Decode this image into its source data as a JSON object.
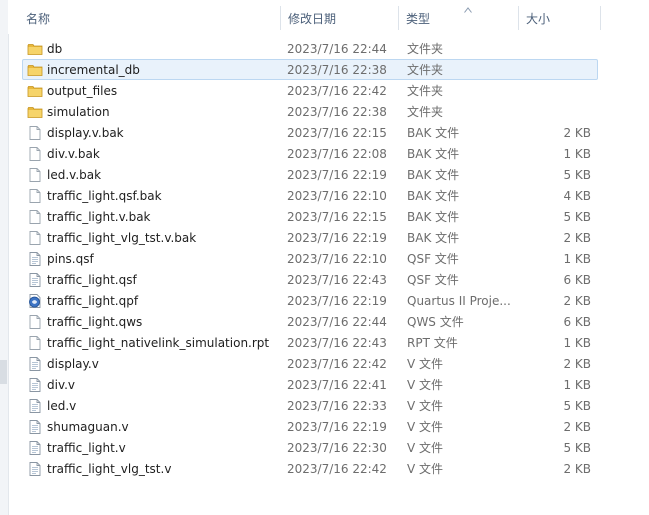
{
  "columns": {
    "name": "名称",
    "date": "修改日期",
    "type": "类型",
    "size": "大小"
  },
  "files": [
    {
      "name": "db",
      "date": "2023/7/16 22:44",
      "type": "文件夹",
      "size": "",
      "icon": "folder-icon"
    },
    {
      "name": "incremental_db",
      "date": "2023/7/16 22:38",
      "type": "文件夹",
      "size": "",
      "icon": "folder-icon",
      "selected": true
    },
    {
      "name": "output_files",
      "date": "2023/7/16 22:42",
      "type": "文件夹",
      "size": "",
      "icon": "folder-icon"
    },
    {
      "name": "simulation",
      "date": "2023/7/16 22:38",
      "type": "文件夹",
      "size": "",
      "icon": "folder-icon"
    },
    {
      "name": "display.v.bak",
      "date": "2023/7/16 22:15",
      "type": "BAK 文件",
      "size": "2 KB",
      "icon": "file-icon"
    },
    {
      "name": "div.v.bak",
      "date": "2023/7/16 22:08",
      "type": "BAK 文件",
      "size": "1 KB",
      "icon": "file-icon"
    },
    {
      "name": "led.v.bak",
      "date": "2023/7/16 22:19",
      "type": "BAK 文件",
      "size": "5 KB",
      "icon": "file-icon"
    },
    {
      "name": "traffic_light.qsf.bak",
      "date": "2023/7/16 22:10",
      "type": "BAK 文件",
      "size": "4 KB",
      "icon": "file-icon"
    },
    {
      "name": "traffic_light.v.bak",
      "date": "2023/7/16 22:15",
      "type": "BAK 文件",
      "size": "5 KB",
      "icon": "file-icon"
    },
    {
      "name": "traffic_light_vlg_tst.v.bak",
      "date": "2023/7/16 22:19",
      "type": "BAK 文件",
      "size": "2 KB",
      "icon": "file-icon"
    },
    {
      "name": "pins.qsf",
      "date": "2023/7/16 22:10",
      "type": "QSF 文件",
      "size": "1 KB",
      "icon": "text-file-icon"
    },
    {
      "name": "traffic_light.qsf",
      "date": "2023/7/16 22:43",
      "type": "QSF 文件",
      "size": "6 KB",
      "icon": "text-file-icon"
    },
    {
      "name": "traffic_light.qpf",
      "date": "2023/7/16 22:19",
      "type": "Quartus II Proje...",
      "size": "2 KB",
      "icon": "quartus-project-icon"
    },
    {
      "name": "traffic_light.qws",
      "date": "2023/7/16 22:44",
      "type": "QWS 文件",
      "size": "6 KB",
      "icon": "file-icon"
    },
    {
      "name": "traffic_light_nativelink_simulation.rpt",
      "date": "2023/7/16 22:43",
      "type": "RPT 文件",
      "size": "1 KB",
      "icon": "file-icon"
    },
    {
      "name": "display.v",
      "date": "2023/7/16 22:42",
      "type": "V 文件",
      "size": "2 KB",
      "icon": "text-file-icon"
    },
    {
      "name": "div.v",
      "date": "2023/7/16 22:41",
      "type": "V 文件",
      "size": "1 KB",
      "icon": "text-file-icon"
    },
    {
      "name": "led.v",
      "date": "2023/7/16 22:33",
      "type": "V 文件",
      "size": "5 KB",
      "icon": "text-file-icon"
    },
    {
      "name": "shumaguan.v",
      "date": "2023/7/16 22:19",
      "type": "V 文件",
      "size": "2 KB",
      "icon": "text-file-icon"
    },
    {
      "name": "traffic_light.v",
      "date": "2023/7/16 22:30",
      "type": "V 文件",
      "size": "5 KB",
      "icon": "text-file-icon"
    },
    {
      "name": "traffic_light_vlg_tst.v",
      "date": "2023/7/16 22:42",
      "type": "V 文件",
      "size": "2 KB",
      "icon": "text-file-icon"
    }
  ]
}
